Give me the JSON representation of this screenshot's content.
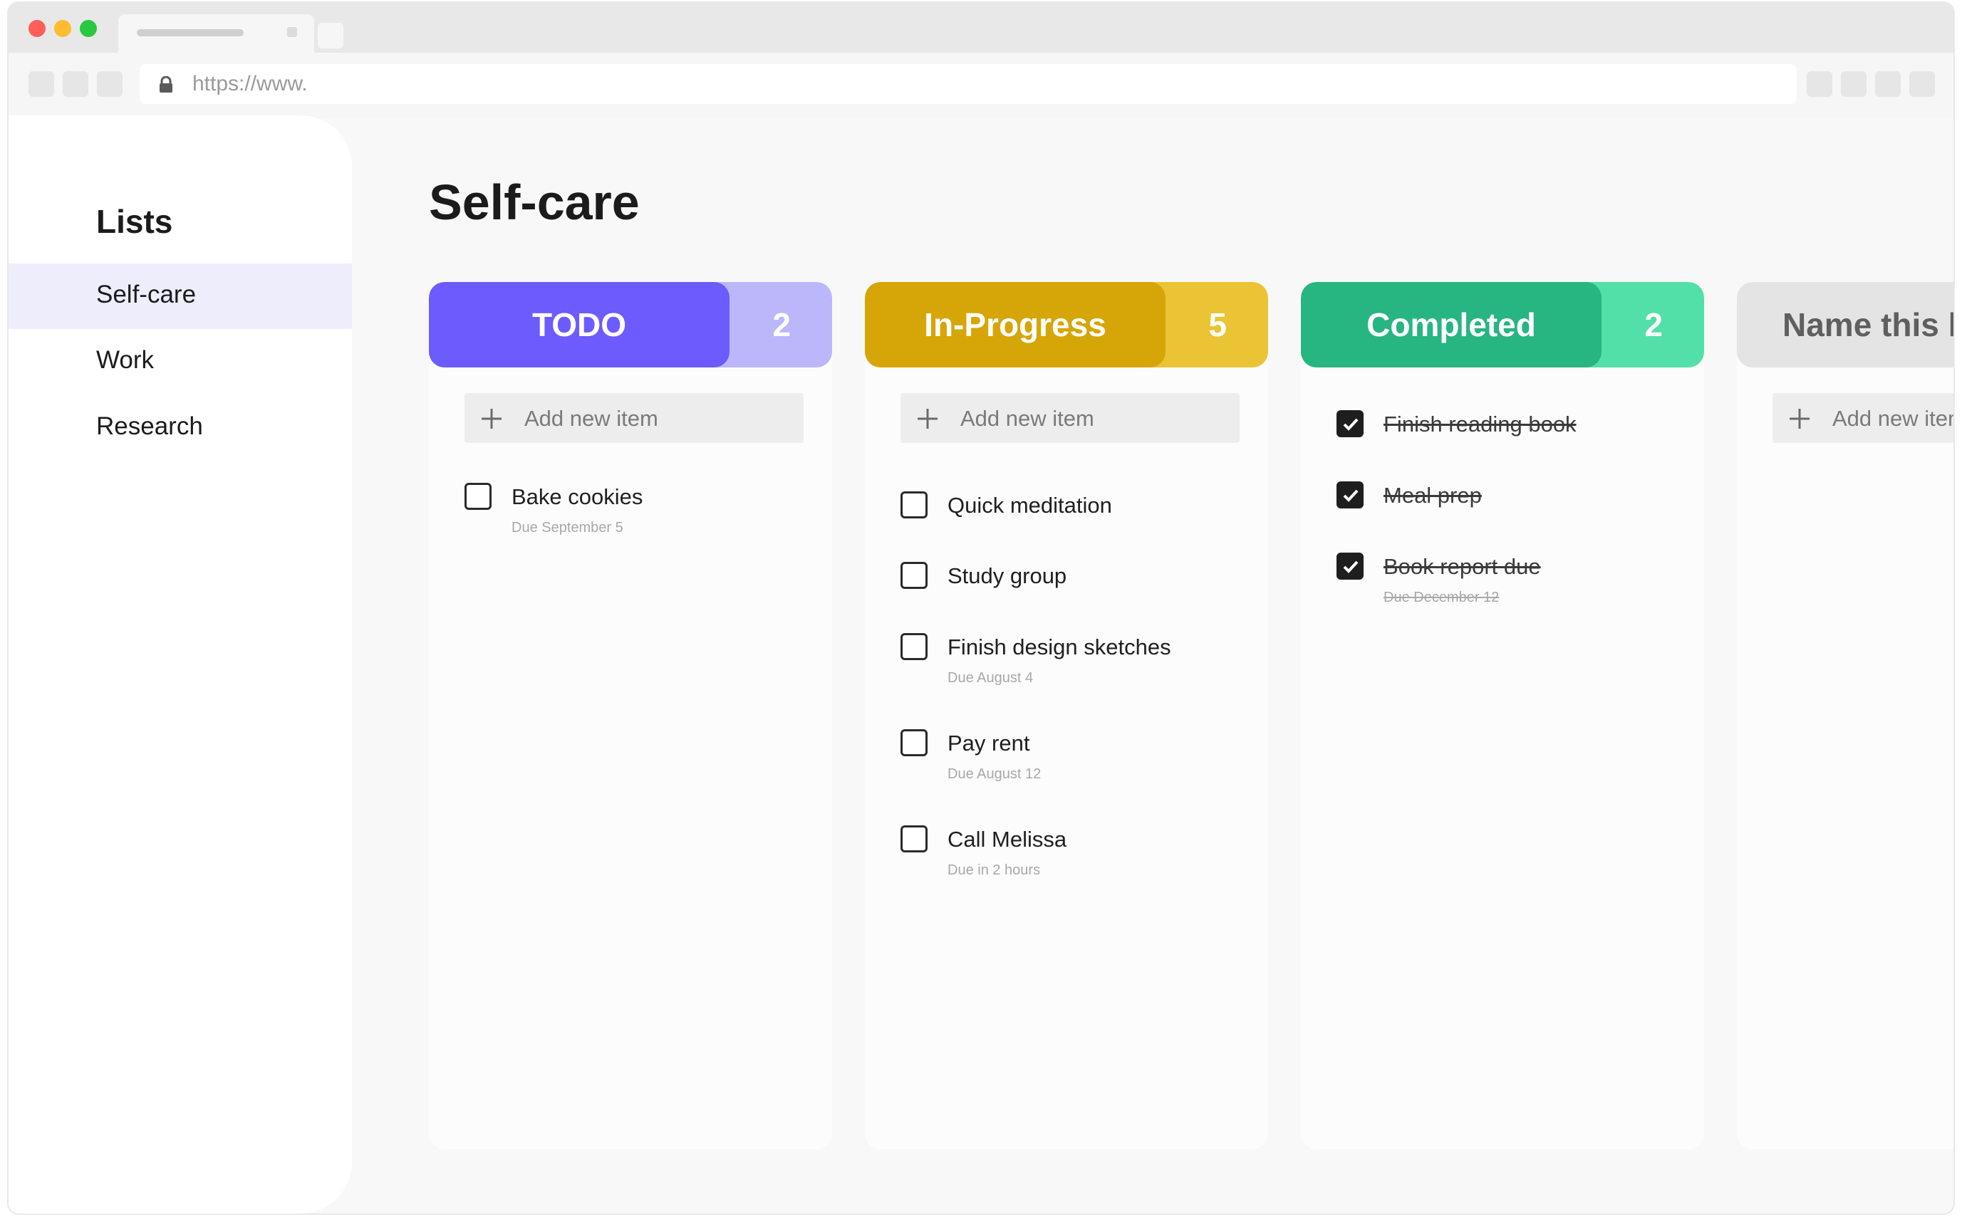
{
  "browser": {
    "url": "https://www."
  },
  "sidebar": {
    "heading": "Lists",
    "items": [
      {
        "label": "Self-care",
        "active": true
      },
      {
        "label": "Work",
        "active": false
      },
      {
        "label": "Research",
        "active": false
      }
    ]
  },
  "page": {
    "title": "Self-care"
  },
  "colors": {
    "todo_main": "#6c5bfd",
    "todo_count": "#bcb6fb",
    "progress_main": "#d6a608",
    "progress_count": "#eac435",
    "completed_main": "#27b581",
    "completed_count": "#52dfa8",
    "new_main": "#e4e4e4"
  },
  "columns": [
    {
      "name": "TODO",
      "count": "2",
      "add_label": "Add new item",
      "tasks": [
        {
          "label": "Bake cookies",
          "due": "Due September 5",
          "done": false
        }
      ]
    },
    {
      "name": "In-Progress",
      "count": "5",
      "add_label": "Add new item",
      "tasks": [
        {
          "label": "Quick meditation",
          "due": "",
          "done": false
        },
        {
          "label": "Study group",
          "due": "",
          "done": false
        },
        {
          "label": "Finish design sketches",
          "due": "Due August 4",
          "done": false
        },
        {
          "label": "Pay rent",
          "due": "Due August 12",
          "done": false
        },
        {
          "label": "Call Melissa",
          "due": "Due in 2 hours",
          "done": false
        }
      ]
    },
    {
      "name": "Completed",
      "count": "2",
      "tasks": [
        {
          "label": "Finish reading book",
          "due": "",
          "done": true
        },
        {
          "label": "Meal prep",
          "due": "",
          "done": true
        },
        {
          "label": "Book report due",
          "due": "Due December 12",
          "done": true
        }
      ]
    },
    {
      "name": "Name this l",
      "add_label": "Add new item"
    }
  ]
}
